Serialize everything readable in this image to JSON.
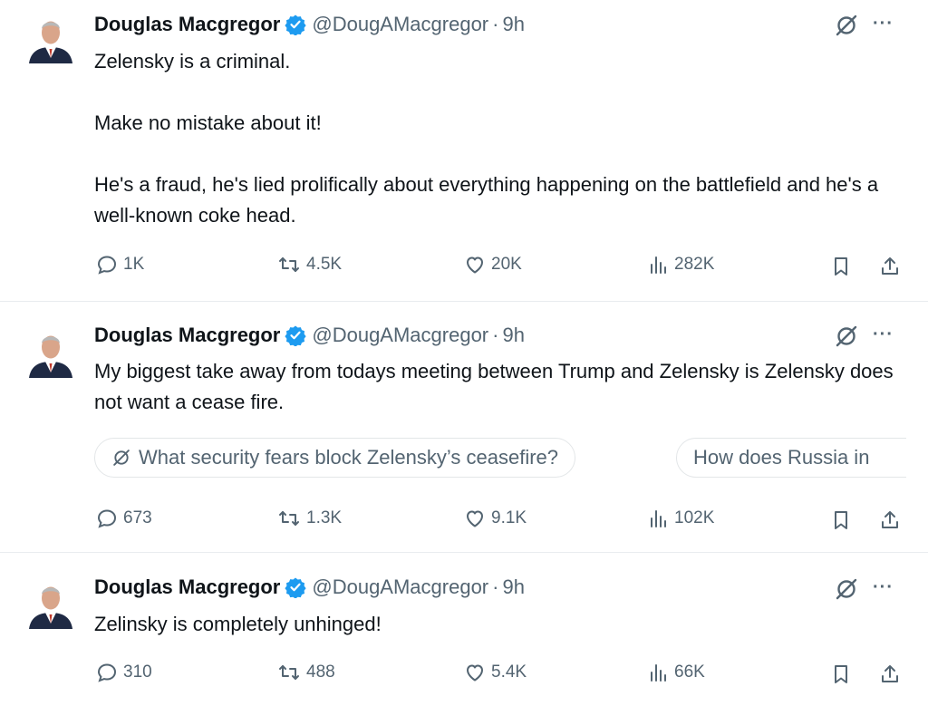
{
  "tweets": [
    {
      "author": {
        "name": "Douglas Macgregor",
        "handle": "@DougAMacgregor",
        "separator": "·",
        "time": "9h",
        "verified": true
      },
      "text": "Zelensky is a criminal.\n\nMake no mistake about it!\n\nHe's a fraud, he's lied prolifically about everything happening on the battlefield and he's a well-known coke head.",
      "stats": {
        "replies": "1K",
        "reposts": "4.5K",
        "likes": "20K",
        "views": "282K"
      }
    },
    {
      "author": {
        "name": "Douglas Macgregor",
        "handle": "@DougAMacgregor",
        "separator": "·",
        "time": "9h",
        "verified": true
      },
      "text": "My biggest take away from todays meeting between Trump and Zelensky is Zelensky does not want a cease fire.",
      "suggestions": [
        "What security fears block Zelensky’s ceasefire?",
        "How does Russia in"
      ],
      "stats": {
        "replies": "673",
        "reposts": "1.3K",
        "likes": "9.1K",
        "views": "102K"
      }
    },
    {
      "author": {
        "name": "Douglas Macgregor",
        "handle": "@DougAMacgregor",
        "separator": "·",
        "time": "9h",
        "verified": true
      },
      "text": "Zelinsky is completely unhinged!",
      "stats": {
        "replies": "310",
        "reposts": "488",
        "likes": "5.4K",
        "views": "66K"
      }
    }
  ],
  "colors": {
    "verified": "#1d9bf0",
    "muted": "#536471",
    "text": "#0f1419",
    "border": "#e9ecef"
  },
  "icons": {
    "reply": "reply-icon",
    "repost": "repost-icon",
    "like": "heart-icon",
    "views": "views-icon",
    "bookmark": "bookmark-icon",
    "share": "share-icon",
    "grok": "grok-icon",
    "more": "more-icon"
  },
  "more_glyph": "···"
}
